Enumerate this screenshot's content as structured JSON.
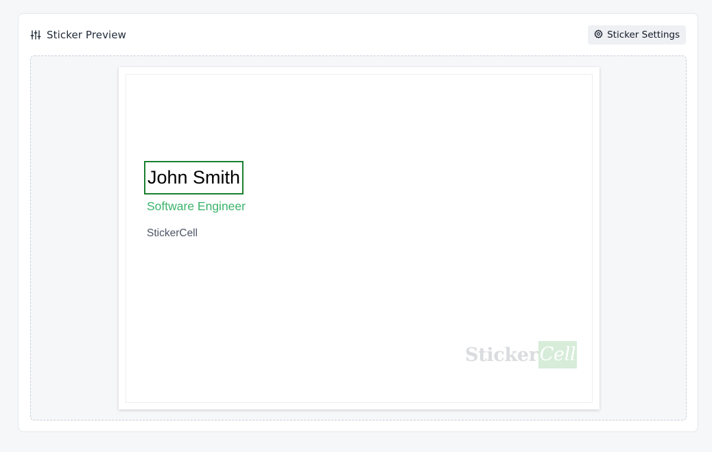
{
  "header": {
    "title": "Sticker Preview",
    "title_icon": "sliders-icon",
    "settings_label": "Sticker Settings",
    "settings_icon": "gear-icon"
  },
  "sticker": {
    "name": "John Smith",
    "role": "Software Engineer",
    "company": "StickerCell",
    "watermark": {
      "part1": "Sticker",
      "part2": "Cell"
    }
  },
  "colors": {
    "name_border": "#1a7f2e",
    "role_text": "#3bb36b",
    "company_text": "#4b5563"
  }
}
